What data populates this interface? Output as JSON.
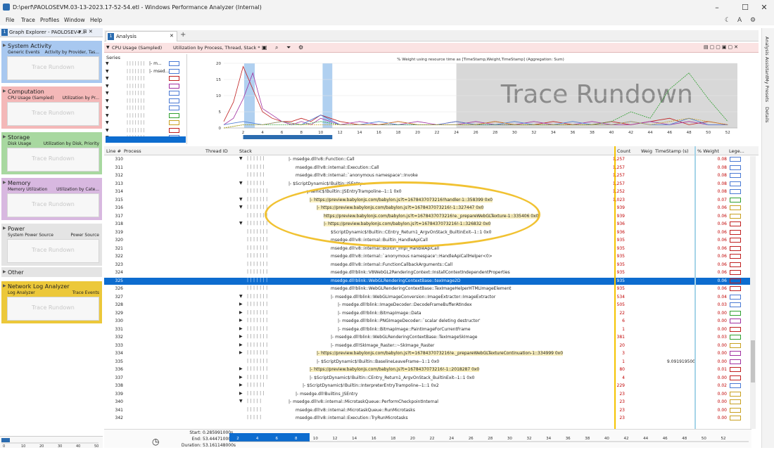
{
  "window": {
    "title": "D:\\perf\\PAOLOSEVM.03-13-2023.17-52-54.etl - Windows Performance Analyzer (Internal)"
  },
  "menu": [
    "File",
    "Trace",
    "Profiles",
    "Window",
    "Help"
  ],
  "graph_explorer": {
    "header": "Graph Explorer - PAOLOSEV4...",
    "cards": [
      {
        "name": "System Activity",
        "sub_left": "Generic Events",
        "sub_right": "Activity by Provider, Tas...",
        "color": "#a8c8f0",
        "watermark": "Trace Rundown"
      },
      {
        "name": "Computation",
        "sub_left": "CPU Usage (Sampled)",
        "sub_right": "Utilization by Pr...",
        "color": "#f4b8b8",
        "watermark": "Trace Rundown"
      },
      {
        "name": "Storage",
        "sub_left": "Disk Usage",
        "sub_right": "Utilization by Disk, Priority",
        "color": "#a8d8a0",
        "watermark": "Trace Rundown"
      },
      {
        "name": "Memory",
        "sub_left": "Memory Utilization",
        "sub_right": "Utilization by Cate...",
        "color": "#d8b8e0",
        "watermark": "Trace Rundown"
      },
      {
        "name": "Power",
        "sub_left": "System Power Source",
        "sub_right": "Power Source",
        "color": "#e4e4e4",
        "watermark": "Trace Rundown"
      },
      {
        "name": "Other",
        "sub_left": "",
        "sub_right": "",
        "color": "#e4e4e4",
        "watermark": ""
      },
      {
        "name": "Network Log Analyzer",
        "sub_left": "Log Analyzer",
        "sub_right": "Trace Events",
        "color": "#ecc83a",
        "watermark": "Trace Rundown"
      }
    ],
    "mini_axis": [
      "0",
      "10",
      "20",
      "30",
      "40",
      "50"
    ]
  },
  "analysis": {
    "tab_label": "Analysis",
    "tab_number": "1",
    "view_title": "CPU Usage (Sampled)",
    "view_preset": "Utilization by Process, Thread, Stack *",
    "series_label": "Series",
    "series_rows": [
      {
        "text": "|- m...",
        "color": "#4a7ad4"
      },
      {
        "text": "|- msed...",
        "color": "#4a7ad4"
      },
      {
        "text": "",
        "color": "#c02020"
      },
      {
        "text": "",
        "color": "#a030a0"
      },
      {
        "text": "",
        "color": "#4a7ad4"
      },
      {
        "text": "",
        "color": "#4a7ad4"
      },
      {
        "text": "",
        "color": "#4a7ad4"
      },
      {
        "text": "",
        "color": "#30a030"
      },
      {
        "text": "",
        "color": "#c8a020"
      },
      {
        "text": "",
        "color": "#c02020"
      },
      {
        "text": "",
        "color": "#4a7ad4"
      }
    ]
  },
  "chart_data": {
    "type": "line",
    "title": "% Weight using resource time as [TimeStamp,Weight,TimeStamp] (Aggregation: Sum)",
    "watermark": "Trace Rundown",
    "x_ticks": [
      2,
      4,
      6,
      8,
      10,
      12,
      14,
      16,
      18,
      20,
      22,
      24,
      26,
      28,
      30,
      32,
      34,
      36,
      38,
      40,
      42,
      44,
      46,
      48,
      50,
      52
    ],
    "y_ticks": [
      0,
      5,
      10,
      15,
      20
    ],
    "ylim": [
      0,
      20
    ],
    "xlim": [
      0,
      53
    ],
    "series": [
      {
        "color": "#c02020",
        "x": [
          0,
          1,
          2,
          3,
          4,
          5,
          6,
          7,
          8,
          9,
          10,
          12,
          14,
          16,
          18,
          20,
          22,
          24,
          26,
          28,
          30,
          32,
          34,
          36,
          38,
          40,
          42,
          44,
          46,
          48,
          50,
          52
        ],
        "y": [
          2,
          8,
          19,
          12,
          5,
          3,
          2,
          2,
          3,
          2,
          4,
          2,
          1,
          1,
          2,
          1,
          1,
          2,
          1,
          2,
          1,
          1,
          2,
          1,
          1,
          2,
          1,
          2,
          3,
          1,
          2,
          1
        ]
      },
      {
        "color": "#a030a0",
        "x": [
          0,
          1,
          2,
          3,
          4,
          5,
          6,
          7,
          8,
          9,
          10,
          12,
          14,
          16,
          18,
          20,
          22,
          24,
          26,
          28,
          30,
          32,
          34,
          36,
          38,
          40,
          42,
          44,
          46,
          48,
          50,
          52
        ],
        "y": [
          1,
          3,
          9,
          17,
          6,
          4,
          2,
          1,
          2,
          1,
          3,
          1,
          2,
          1,
          1,
          2,
          1,
          1,
          2,
          1,
          1,
          2,
          1,
          1,
          2,
          1,
          1,
          2,
          1,
          2,
          1,
          1
        ]
      },
      {
        "color": "#4a7ad4",
        "x": [
          0,
          2,
          4,
          6,
          8,
          10,
          12,
          14,
          16,
          18,
          20,
          22,
          24,
          26,
          28,
          30,
          32,
          34,
          36,
          38,
          40,
          42,
          44,
          46,
          48,
          50,
          52
        ],
        "y": [
          1,
          2,
          1,
          2,
          1,
          4,
          1,
          1,
          2,
          1,
          1,
          1,
          2,
          1,
          1,
          2,
          1,
          1,
          2,
          1,
          1,
          2,
          1,
          1,
          3,
          1,
          1
        ]
      },
      {
        "color": "#30a030",
        "x": [
          0,
          2,
          4,
          6,
          8,
          10,
          12,
          14,
          16,
          18,
          20,
          22,
          24,
          26,
          28,
          30,
          32,
          34,
          36,
          38,
          40,
          42,
          44,
          46,
          48,
          50,
          52
        ],
        "y": [
          0,
          1,
          1,
          1,
          1,
          2,
          1,
          1,
          1,
          1,
          1,
          1,
          1,
          1,
          1,
          1,
          1,
          1,
          1,
          1,
          2,
          5,
          3,
          12,
          17,
          9,
          2
        ]
      },
      {
        "color": "#c8a020",
        "x": [
          0,
          2,
          4,
          6,
          8,
          10,
          12,
          14,
          16,
          18,
          20,
          22,
          24,
          26,
          28,
          30,
          32,
          34,
          36,
          38,
          40,
          42,
          44,
          46,
          48,
          50,
          52
        ],
        "y": [
          0,
          1,
          1,
          2,
          1,
          1,
          1,
          1,
          1,
          2,
          1,
          1,
          1,
          1,
          2,
          1,
          1,
          1,
          1,
          1,
          1,
          2,
          1,
          2,
          3,
          2,
          1
        ]
      }
    ]
  },
  "grid": {
    "columns": [
      "Line #",
      "Process",
      "Thread ID",
      "Stack",
      "Count",
      "Weig",
      "TimeStamp (s)",
      "% Weight",
      "Lege..."
    ],
    "rows": [
      {
        "line": "310",
        "pipes": "| | | | | |",
        "arrow": "▼",
        "stack": "|- msedge.dll!v8::Function::Call",
        "indent": 0,
        "count": "1,257",
        "ts": "",
        "pw": "0.08",
        "color": "#4a7ad4",
        "hl": false,
        "sel": false
      },
      {
        "line": "311",
        "pipes": "| | | | | |",
        "arrow": "",
        "stack": "msedge.dll!v8::internal::Execution::Call",
        "indent": 1,
        "count": "1,257",
        "ts": "",
        "pw": "0.08",
        "color": "#4a7ad4",
        "hl": false,
        "sel": false
      },
      {
        "line": "312",
        "pipes": "| | | | | |",
        "arrow": "",
        "stack": "msedge.dll!v8::internal::`anonymous namespace'::Invoke",
        "indent": 1,
        "count": "1,257",
        "ts": "",
        "pw": "0.08",
        "color": "#4a7ad4",
        "hl": false,
        "sel": false
      },
      {
        "line": "313",
        "pipes": "| | | | | |",
        "arrow": "▼",
        "stack": "|- $ScriptDynamic$!Builtin::JSEntry...",
        "indent": 0,
        "count": "1,257",
        "ts": "",
        "pw": "0.08",
        "color": "#4a7ad4",
        "hl": false,
        "sel": false
      },
      {
        "line": "314",
        "pipes": "| | | | | | |",
        "arrow": "",
        "stack": "...ynamic$!Builtin::JSEntryTrampoline--1::1 0x0",
        "indent": 2,
        "count": "1,252",
        "ts": "",
        "pw": "0.08",
        "color": "#4a7ad4",
        "hl": false,
        "sel": false
      },
      {
        "line": "315",
        "pipes": "| | | | | | |",
        "arrow": "▼",
        "stack": "|- https://preview.babylonjs.com/babylon.js?t=1678437073216!handler-1::358399 0x0",
        "indent": 3,
        "count": "1,023",
        "ts": "",
        "pw": "0.07",
        "color": "#30a030",
        "hl": true,
        "sel": false
      },
      {
        "line": "316",
        "pipes": "| | | | | | |",
        "arrow": "▼",
        "stack": "|- https://preview.babylonjs.com/babylon.js?t=1678437073216!-1::327447 0x0",
        "indent": 4,
        "count": "939",
        "ts": "",
        "pw": "0.06",
        "color": "#c8a020",
        "hl": true,
        "sel": false
      },
      {
        "line": "317",
        "pipes": "| | | | | | |",
        "arrow": "",
        "stack": "https://preview.babylonjs.com/babylon.js?t=1678437073216!e._prepareWebGLTexture-1::335406 0x0",
        "indent": 5,
        "count": "939",
        "ts": "",
        "pw": "0.06",
        "color": "#c8a020",
        "hl": true,
        "sel": false
      },
      {
        "line": "318",
        "pipes": "| | | | | | |",
        "arrow": "▼",
        "stack": "|- https://preview.babylonjs.com/babylon.js?t=1678437073216!-1::326832 0x0",
        "indent": 5,
        "count": "936",
        "ts": "",
        "pw": "0.06",
        "color": "#c02020",
        "hl": true,
        "sel": false
      },
      {
        "line": "319",
        "pipes": "| | | | | | |",
        "arrow": "",
        "stack": "$ScriptDynamic$!Builtin::CEntry_Return1_ArgvOnStack_BuiltinExit--1::1 0x0",
        "indent": 6,
        "count": "936",
        "ts": "",
        "pw": "0.06",
        "color": "#c02020",
        "hl": false,
        "sel": false
      },
      {
        "line": "320",
        "pipes": "| | | | | | |",
        "arrow": "",
        "stack": "msedge.dll!v8::internal::Builtin_HandleApiCall",
        "indent": 6,
        "count": "935",
        "ts": "",
        "pw": "0.06",
        "color": "#c02020",
        "hl": false,
        "sel": false
      },
      {
        "line": "321",
        "pipes": "| | | | | | |",
        "arrow": "",
        "stack": "msedge.dll!v8::internal::Builtin_Impl_HandleApiCall",
        "indent": 6,
        "count": "935",
        "ts": "",
        "pw": "0.06",
        "color": "#c02020",
        "hl": false,
        "sel": false
      },
      {
        "line": "322",
        "pipes": "| | | | | | |",
        "arrow": "",
        "stack": "msedge.dll!v8::internal::`anonymous namespace'::HandleApiCallHelper<0>",
        "indent": 6,
        "count": "935",
        "ts": "",
        "pw": "0.06",
        "color": "#c02020",
        "hl": false,
        "sel": false
      },
      {
        "line": "323",
        "pipes": "| | | | | | |",
        "arrow": "",
        "stack": "msedge.dll!v8::internal::FunctionCallbackArguments::Call",
        "indent": 6,
        "count": "935",
        "ts": "",
        "pw": "0.06",
        "color": "#c02020",
        "hl": false,
        "sel": false
      },
      {
        "line": "324",
        "pipes": "| | | | | | |",
        "arrow": "",
        "stack": "msedge.dll!blink::V8WebGL2RenderingContext::InstallContextIndependentProperties",
        "indent": 6,
        "count": "935",
        "ts": "",
        "pw": "0.06",
        "color": "#c02020",
        "hl": false,
        "sel": false
      },
      {
        "line": "325",
        "pipes": "| | | | | | |",
        "arrow": "",
        "stack": "msedge.dll!blink::WebGLRenderingContextBase::texImage2D",
        "indent": 6,
        "count": "935",
        "ts": "",
        "pw": "0.06",
        "color": "#c02020",
        "hl": false,
        "sel": true
      },
      {
        "line": "326",
        "pipes": "| | | | | | |",
        "arrow": "",
        "stack": "msedge.dll!blink::WebGLRenderingContextBase::TexImageHelperHTMLImageElement",
        "indent": 6,
        "count": "935",
        "ts": "",
        "pw": "0.06",
        "color": "#c02020",
        "hl": false,
        "sel": false
      },
      {
        "line": "327",
        "pipes": "| | | | | | |",
        "arrow": "▼",
        "stack": "|- msedge.dll!blink::WebGLImageConversion::ImageExtractor::ImageExtractor",
        "indent": 6,
        "count": "534",
        "ts": "",
        "pw": "0.04",
        "color": "#4a7ad4",
        "hl": false,
        "sel": false
      },
      {
        "line": "328",
        "pipes": "| | | | | | |",
        "arrow": "▶",
        "stack": "|- msedge.dll!blink::ImageDecoder::DecodeFrameBufferAtIndex",
        "indent": 7,
        "count": "505",
        "ts": "",
        "pw": "0.03",
        "color": "#4a7ad4",
        "hl": false,
        "sel": false
      },
      {
        "line": "329",
        "pipes": "| | | | | | |",
        "arrow": "▶",
        "stack": "|- msedge.dll!blink::BitmapImage::Data",
        "indent": 7,
        "count": "22",
        "ts": "",
        "pw": "0.00",
        "color": "#30a030",
        "hl": false,
        "sel": false
      },
      {
        "line": "330",
        "pipes": "| | | | | | |",
        "arrow": "▶",
        "stack": "|- msedge.dll!blink::PNGImageDecoder::`scalar deleting destructor'",
        "indent": 7,
        "count": "6",
        "ts": "",
        "pw": "0.00",
        "color": "#a030a0",
        "hl": false,
        "sel": false
      },
      {
        "line": "331",
        "pipes": "| | | | | | |",
        "arrow": "▶",
        "stack": "|- msedge.dll!blink::BitmapImage::PaintImageForCurrentFrame",
        "indent": 7,
        "count": "1",
        "ts": "",
        "pw": "0.00",
        "color": "#c02020",
        "hl": false,
        "sel": false
      },
      {
        "line": "332",
        "pipes": "| | | | | | |",
        "arrow": "▶",
        "stack": "|- msedge.dll!blink::WebGLRenderingContextBase::TexImageSkImage",
        "indent": 6,
        "count": "381",
        "ts": "",
        "pw": "0.03",
        "color": "#30a030",
        "hl": false,
        "sel": false
      },
      {
        "line": "333",
        "pipes": "| | | | | | |",
        "arrow": "▶",
        "stack": "|- msedge.dll!SkImage_Raster::~SkImage_Raster",
        "indent": 6,
        "count": "20",
        "ts": "",
        "pw": "0.00",
        "color": "#c8a020",
        "hl": false,
        "sel": false
      },
      {
        "line": "334",
        "pipes": "| | | | | | |",
        "arrow": "▶",
        "stack": "|- https://preview.babylonjs.com/babylon.js?t=1678437073216!e._prepareWebGLTextureContinuation-1::334999 0x0",
        "indent": 4,
        "count": "3",
        "ts": "",
        "pw": "0.00",
        "color": "#a030a0",
        "hl": true,
        "sel": false
      },
      {
        "line": "335",
        "pipes": "| | | | | | |",
        "arrow": "",
        "stack": "|- $ScriptDynamic$!Builtin::BaselineLeaveFrame--1::1 0x0",
        "indent": 4,
        "count": "1",
        "ts": "9.091919500",
        "pw": "0.00",
        "color": "#a030a0",
        "hl": false,
        "sel": false
      },
      {
        "line": "336",
        "pipes": "| | | | | | |",
        "arrow": "▶",
        "stack": "|- https://preview.babylonjs.com/babylon.js?t=1678437073216!-1::2018287 0x0",
        "indent": 3,
        "count": "80",
        "ts": "",
        "pw": "0.01",
        "color": "#c02020",
        "hl": true,
        "sel": false
      },
      {
        "line": "337",
        "pipes": "| | | | | | |",
        "arrow": "▶",
        "stack": "|- $ScriptDynamic$!Builtin::CEntry_Return1_ArgvOnStack_BuiltinExit--1::1 0x0",
        "indent": 3,
        "count": "4",
        "ts": "",
        "pw": "0.00",
        "color": "#c02020",
        "hl": false,
        "sel": false
      },
      {
        "line": "338",
        "pipes": "| | | | | |",
        "arrow": "▶",
        "stack": "|- $ScriptDynamic$!Builtin::InterpreterEntryTrampoline--1::1 0x2",
        "indent": 2,
        "count": "229",
        "ts": "",
        "pw": "0.02",
        "color": "#4a7ad4",
        "hl": false,
        "sel": false
      },
      {
        "line": "339",
        "pipes": "| | | | | |",
        "arrow": "▶",
        "stack": "|- msedge.dll!Builtins_JSEntry",
        "indent": 1,
        "count": "23",
        "ts": "",
        "pw": "0.00",
        "color": "#c8a020",
        "hl": false,
        "sel": false
      },
      {
        "line": "340",
        "pipes": "| | | | |",
        "arrow": "▼",
        "stack": "|- msedge.dll!v8::internal::MicrotaskQueue::PerformCheckpointInternal",
        "indent": 0,
        "count": "23",
        "ts": "",
        "pw": "0.00",
        "color": "#c8a020",
        "hl": false,
        "sel": false
      },
      {
        "line": "341",
        "pipes": "| | | | |",
        "arrow": "",
        "stack": "msedge.dll!v8::internal::MicrotaskQueue::RunMicrotasks",
        "indent": 1,
        "count": "23",
        "ts": "",
        "pw": "0.00",
        "color": "#c8a020",
        "hl": false,
        "sel": false
      },
      {
        "line": "342",
        "pipes": "| | | | |",
        "arrow": "",
        "stack": "msedge.dll!v8::internal::Execution::TryRunMicrotasks",
        "indent": 1,
        "count": "23",
        "ts": "",
        "pw": "0.00",
        "color": "#c8a020",
        "hl": false,
        "sel": false
      }
    ]
  },
  "bottom": {
    "start_label": "Start:",
    "start": "0.285991000s",
    "end_label": "End:",
    "end": "53.444710000s",
    "duration_label": "Duration:",
    "duration": "53.161148000s",
    "axis": [
      "2",
      "4",
      "6",
      "8",
      "10",
      "12",
      "14",
      "16",
      "18",
      "20",
      "22",
      "24",
      "26",
      "28",
      "30",
      "32",
      "34",
      "36",
      "38",
      "40",
      "42",
      "44",
      "46",
      "48",
      "50",
      "52"
    ]
  },
  "right_panel": [
    "Analysis Assistant",
    "My Presets",
    "Details"
  ]
}
